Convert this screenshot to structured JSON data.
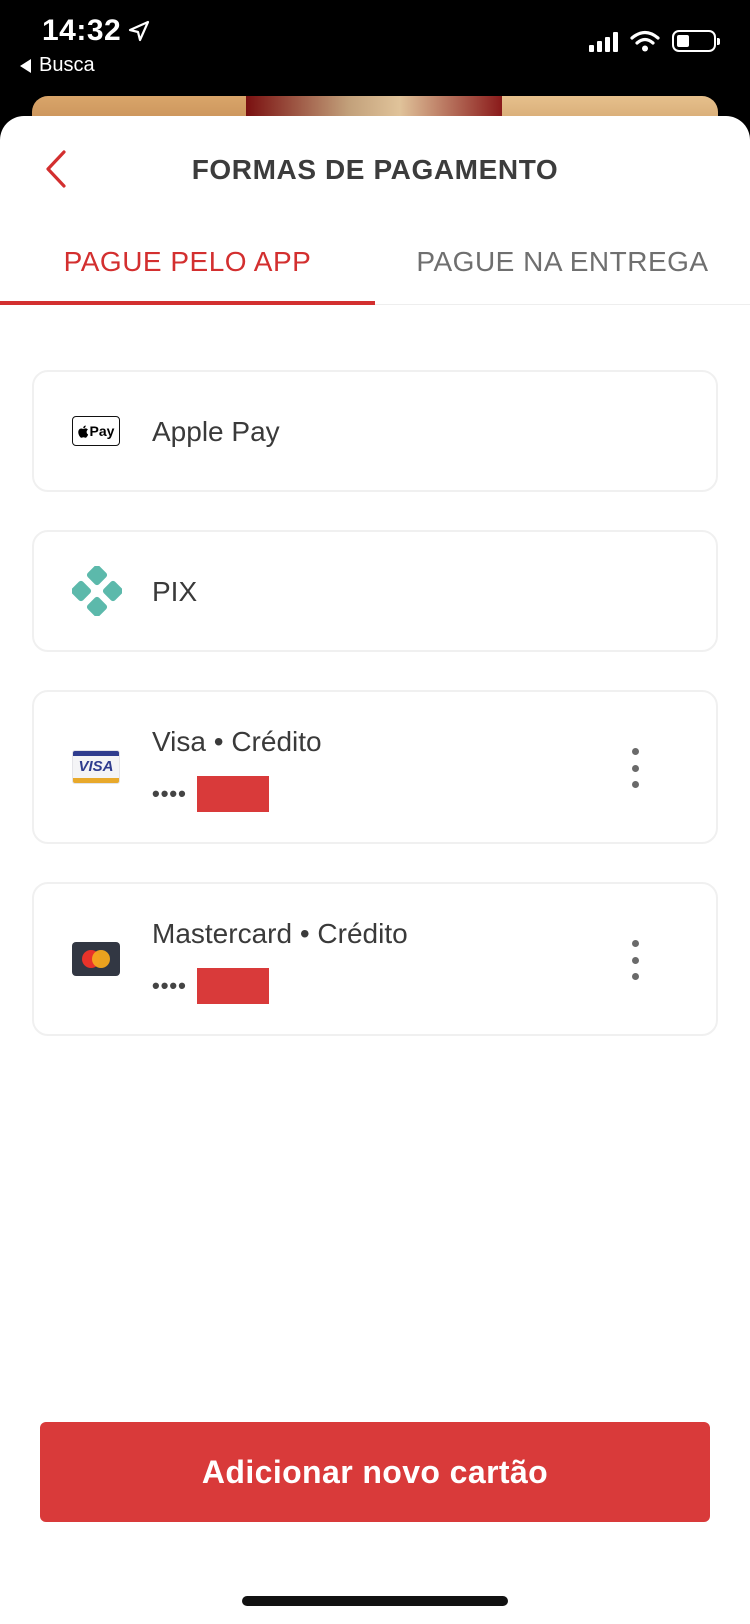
{
  "status_bar": {
    "time": "14:32",
    "back_app_label": "Busca"
  },
  "header": {
    "title": "FORMAS DE PAGAMENTO",
    "back_icon": "chevron-left-icon",
    "accent_color": "#d32f2f"
  },
  "tabs": [
    {
      "label": "PAGUE PELO APP",
      "active": true
    },
    {
      "label": "PAGUE NA ENTREGA",
      "active": false
    }
  ],
  "payment_methods": [
    {
      "label": "Apple Pay",
      "icon": "apple-pay-icon",
      "badge_text": "Pay"
    },
    {
      "label": "PIX",
      "icon": "pix-icon"
    },
    {
      "label": "Visa • Crédito",
      "icon": "visa-card-icon",
      "badge_text": "VISA",
      "masked": "••••"
    },
    {
      "label": "Mastercard • Crédito",
      "icon": "mastercard-card-icon",
      "masked": "••••"
    }
  ],
  "cta": {
    "label": "Adicionar novo cartão",
    "color": "#d93a3a"
  }
}
